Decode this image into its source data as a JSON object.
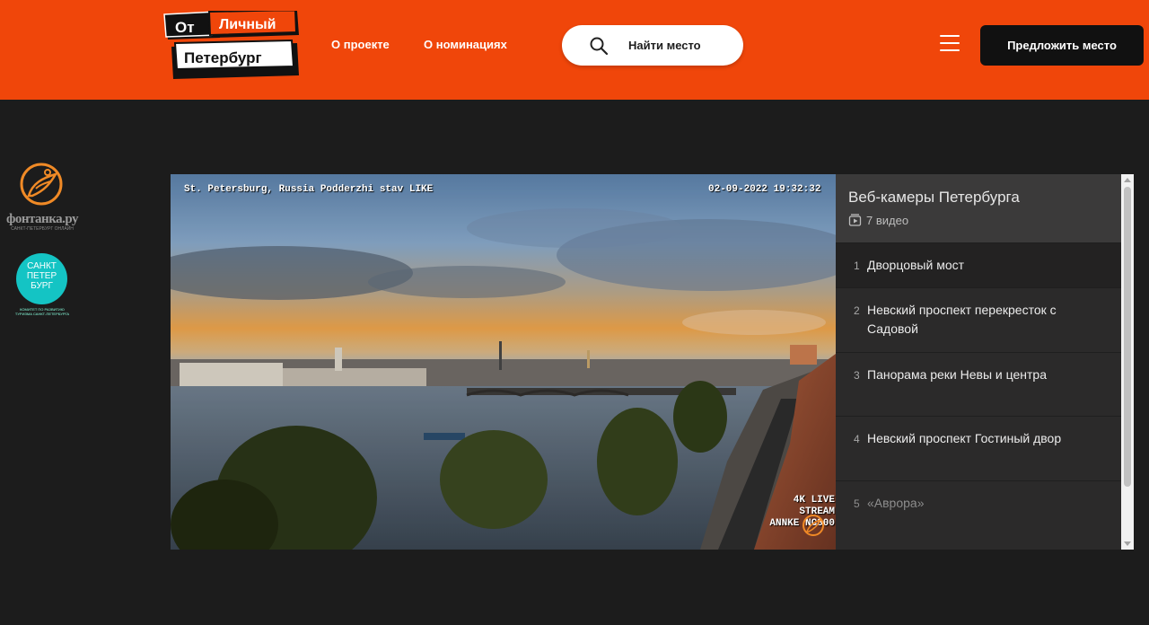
{
  "header": {
    "logo": {
      "word_ot": "От",
      "word_lichny": "Личный",
      "word_peterburg": "Петербург"
    },
    "nav": {
      "about": "О проекте",
      "nominations": "О номинациях"
    },
    "search_label": "Найти место",
    "suggest_label": "Предложить место",
    "colors": {
      "bar": "#f0460a",
      "dark_button": "#111111"
    }
  },
  "partners": {
    "fontanka": {
      "name": "фонтанка.ру",
      "tagline": "САНКТ-ПЕТЕРБУРГ ОНЛАЙН"
    },
    "spb": {
      "lines": [
        "САНКТ",
        "ПЕТЕР",
        "БУРГ"
      ],
      "tagline": "КОМИТЕТ ПО РАЗВИТИЮ ТУРИЗМА САНКТ-ПЕТЕРБУРГА"
    }
  },
  "player": {
    "overlay_title": "St. Petersburg, Russia Podderzhi stav LIKE",
    "overlay_datetime": "02-09-2022 19:32:32",
    "overlay_stream": "4K LIVE STREAM",
    "overlay_camera": "ANNKE NC800"
  },
  "playlist": {
    "title": "Веб-камеры Петербурга",
    "count": "7 видео",
    "items": [
      {
        "num": "1",
        "label": "Дворцовый мост"
      },
      {
        "num": "2",
        "label": "Невский проспект перекресток с Садовой"
      },
      {
        "num": "3",
        "label": "Панорама реки Невы и центра"
      },
      {
        "num": "4",
        "label": "Невский проспект Гостиный двор"
      },
      {
        "num": "5",
        "label": "«Аврора»"
      }
    ]
  }
}
